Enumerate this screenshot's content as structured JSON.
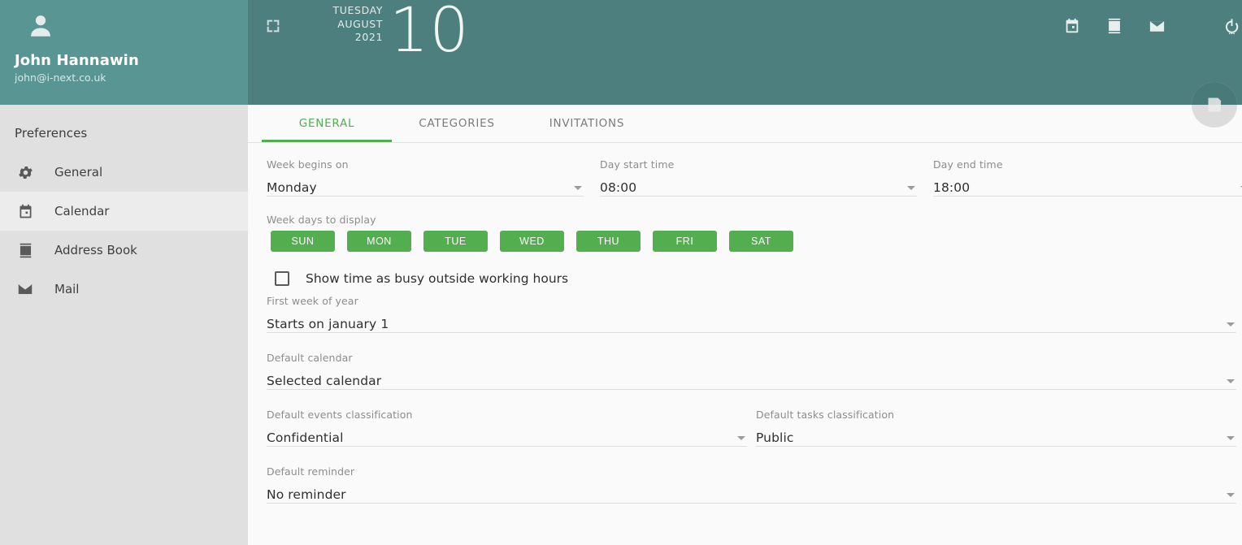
{
  "colors": {
    "teal_header": "#4d7f7e",
    "teal_profile": "#599693",
    "accent_green": "#52ae4f",
    "sidebar_bg": "#e0e0e0",
    "sidebar_selected": "#ececec",
    "content_bg": "#fafafa"
  },
  "sidebar": {
    "profile": {
      "avatar_icon": "person-icon",
      "name": "John Hannawin",
      "email": "john@i-next.co.uk"
    },
    "section_title": "Preferences",
    "items": [
      {
        "label": "General",
        "icon": "gear-icon",
        "selected": false
      },
      {
        "label": "Calendar",
        "icon": "calendar-icon",
        "selected": true
      },
      {
        "label": "Address Book",
        "icon": "address-book-icon",
        "selected": false
      },
      {
        "label": "Mail",
        "icon": "mail-icon",
        "selected": false
      }
    ]
  },
  "topbar": {
    "expand_icon": "fullscreen-icon",
    "weekday": "TUESDAY",
    "month": "AUGUST",
    "year": "2021",
    "day": "10",
    "icons": [
      {
        "name": "calendar-icon"
      },
      {
        "name": "address-book-icon"
      },
      {
        "name": "mail-icon"
      },
      {
        "name": "power-icon"
      }
    ],
    "save_fab_icon": "save-icon"
  },
  "tabs": [
    {
      "label": "GENERAL",
      "active": true
    },
    {
      "label": "CATEGORIES",
      "active": false
    },
    {
      "label": "INVITATIONS",
      "active": false
    }
  ],
  "form": {
    "week_begins_on": {
      "label": "Week begins on",
      "value": "Monday"
    },
    "day_start_time": {
      "label": "Day start time",
      "value": "08:00"
    },
    "day_end_time": {
      "label": "Day end time",
      "value": "18:00"
    },
    "week_days": {
      "label": "Week days to display",
      "days": [
        "SUN",
        "MON",
        "TUE",
        "WED",
        "THU",
        "FRI",
        "SAT"
      ]
    },
    "busy_checkbox": {
      "label": "Show time as busy outside working hours",
      "checked": false
    },
    "first_week": {
      "label": "First week of year",
      "value": "Starts on january 1"
    },
    "default_calendar": {
      "label": "Default calendar",
      "value": "Selected calendar"
    },
    "events_class": {
      "label": "Default events classification",
      "value": "Confidential"
    },
    "tasks_class": {
      "label": "Default tasks classification",
      "value": "Public"
    },
    "default_reminder": {
      "label": "Default reminder",
      "value": "No reminder"
    }
  }
}
